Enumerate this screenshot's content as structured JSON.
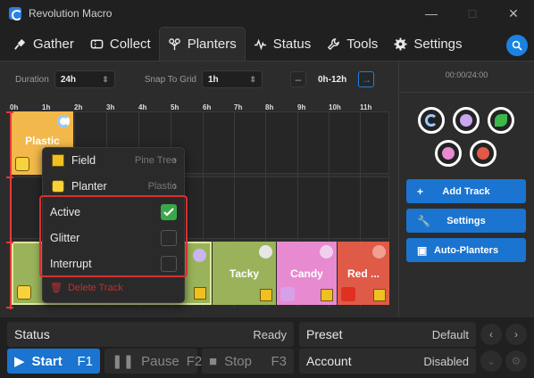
{
  "window": {
    "title": "Revolution Macro"
  },
  "tabs": [
    {
      "label": "Gather"
    },
    {
      "label": "Collect"
    },
    {
      "label": "Planters"
    },
    {
      "label": "Status"
    },
    {
      "label": "Tools"
    },
    {
      "label": "Settings"
    }
  ],
  "controls": {
    "duration_label": "Duration",
    "duration_value": "24h",
    "snap_label": "Snap To Grid",
    "snap_value": "1h",
    "range_label": "0h-12h",
    "prev_icon": "–",
    "next_icon": "→"
  },
  "timeline": {
    "hours": [
      "0h",
      "1h",
      "2h",
      "3h",
      "4h",
      "5h",
      "6h",
      "7h",
      "8h",
      "9h",
      "10h",
      "11h"
    ]
  },
  "blocks": {
    "plastic": "Plastic",
    "tacky": "Tacky",
    "candy": "Candy",
    "red": "Red ..."
  },
  "context_menu": {
    "field_label": "Field",
    "field_hint": "Pine Tree",
    "planter_label": "Planter",
    "planter_hint": "Plastic",
    "active_label": "Active",
    "glitter_label": "Glitter",
    "interrupt_label": "Interrupt",
    "active_checked": true,
    "glitter_checked": false,
    "interrupt_checked": false,
    "delete_label": "Delete Track"
  },
  "side": {
    "timer": "00:00/24:00",
    "add_track": "Add Track",
    "settings": "Settings",
    "auto_planters": "Auto-Planters"
  },
  "bottom": {
    "status_label": "Status",
    "status_value": "Ready",
    "preset_label": "Preset",
    "preset_value": "Default",
    "start_label": "Start",
    "start_key": "F1",
    "pause_label": "Pause",
    "pause_key": "F2",
    "stop_label": "Stop",
    "stop_key": "F3",
    "account_label": "Account",
    "account_value": "Disabled"
  },
  "colors": {
    "accent": "#1a74d0",
    "plastic": "#f2b84b",
    "tacky": "#9ab35a",
    "candy": "#e88ad0",
    "red": "#e05a48",
    "selection_red": "#d83030",
    "active_green": "#3aa84a"
  }
}
